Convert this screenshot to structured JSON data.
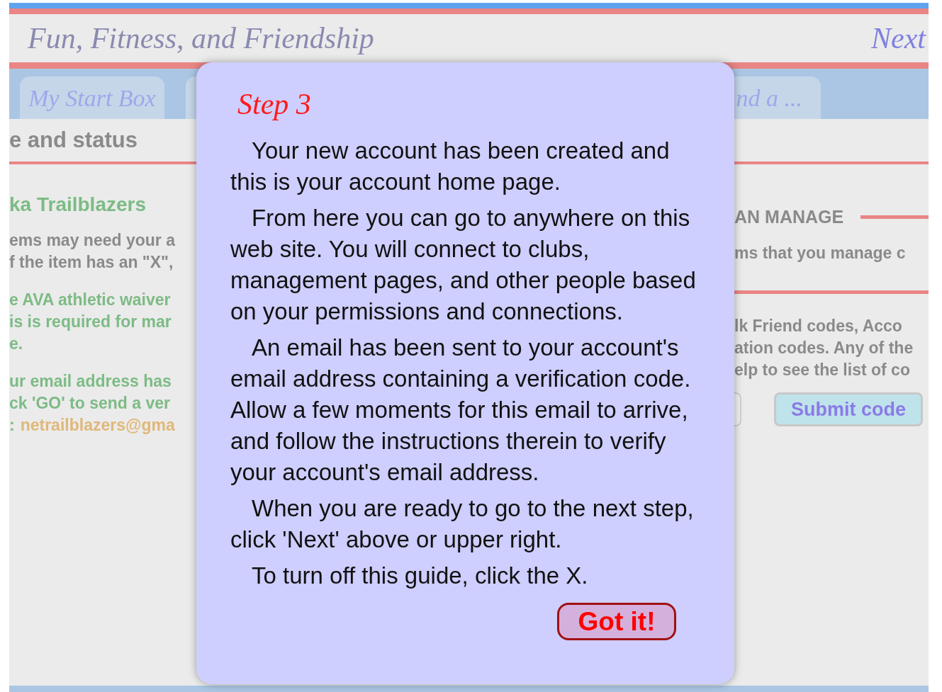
{
  "header": {
    "title": "Fun, Fitness, and Friendship",
    "next_link": "Next"
  },
  "tabs": [
    {
      "label": "My Start Box"
    },
    {
      "label": "nd a ..."
    }
  ],
  "left_panel": {
    "heading": "e and status",
    "club_name": "ka Trailblazers",
    "notes": [
      {
        "kind": "gray",
        "lines": [
          "ems may need your a",
          "f the item has an \"X\","
        ]
      },
      {
        "kind": "green",
        "lines": [
          "e AVA athletic waiver",
          "is is required for mar",
          "e."
        ]
      },
      {
        "kind": "green",
        "lines": [
          "ur email address has",
          "ck 'GO' to send a ver"
        ]
      }
    ],
    "email_prefix": ":",
    "email": "netrailblazers@gma"
  },
  "right_panel": {
    "heading": "AN MANAGE",
    "manage_text": "ms that you manage c",
    "codes_lines": [
      "lk Friend codes, Acco",
      "ation codes. Any of the",
      "elp to see the list of co"
    ],
    "submit_button": "Submit code"
  },
  "guide": {
    "title": "Step 3",
    "paragraphs": [
      "Your new account has been created and this is your account home page.",
      "From here you can go to anywhere on this web site. You will connect to clubs, management pages, and other people based on your permissions and connections.",
      "An email has been sent to your account's email address containing a verification code. Allow a few moments for this email to arrive, and follow the instructions therein to verify your account's email address.",
      "When you are ready to go to the next step, click 'Next' above or upper right.",
      "To turn off this guide, click the X."
    ],
    "button": "Got it!"
  }
}
